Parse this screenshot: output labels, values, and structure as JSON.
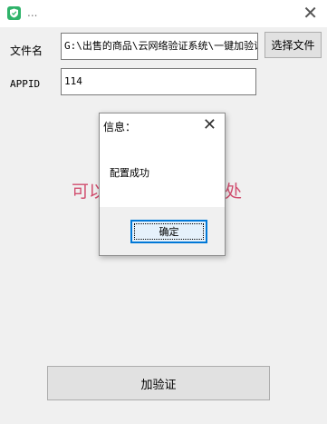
{
  "window": {
    "title": "...",
    "close_glyph": "✕"
  },
  "form": {
    "file_label": "文件名",
    "file_path": "G:\\出售的商品\\云网络验证系统\\一键加验证",
    "browse_label": "选择文件",
    "appid_label": "APPID",
    "appid_value": "114",
    "background_text_left": "可以",
    "background_text_right": "处",
    "submit_label": "加验证"
  },
  "dialog": {
    "title": "信息：",
    "close_glyph": "✕",
    "message": "配置成功",
    "ok_label": "确定"
  },
  "colors": {
    "accent": "#0078d7",
    "background_text": "#d14d6e",
    "app_icon": "#2fb36a"
  }
}
